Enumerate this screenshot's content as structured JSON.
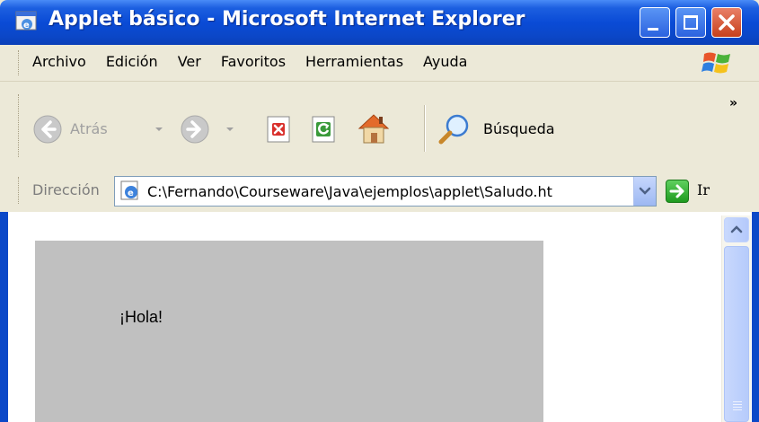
{
  "window": {
    "title": "Applet básico - Microsoft Internet Explorer"
  },
  "menu": {
    "items": [
      "Archivo",
      "Edición",
      "Ver",
      "Favoritos",
      "Herramientas",
      "Ayuda"
    ]
  },
  "toolbar": {
    "back_label": "Atrás",
    "search_label": "Búsqueda",
    "more_label": "»"
  },
  "address": {
    "label": "Dirección",
    "value": "C:\\Fernando\\Courseware\\Java\\ejemplos\\applet\\Saludo.ht",
    "go_label": "Ir"
  },
  "content": {
    "applet_text": "¡Hola!"
  },
  "colors": {
    "titlebar": "#0a4bd6",
    "chrome": "#ece9d8",
    "applet_bg": "#c0c0c0",
    "frame": "#0b48c8"
  }
}
